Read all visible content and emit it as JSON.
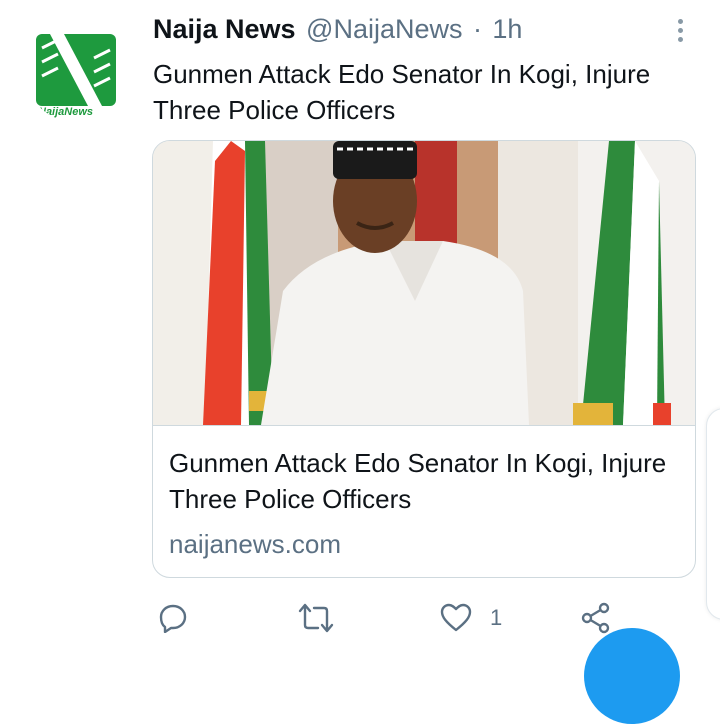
{
  "tweet": {
    "author_name": "Naija News",
    "handle": "@NaijaNews",
    "separator": "·",
    "time": "1h",
    "text": "Gunmen Attack Edo Senator In Kogi, Injure Three Police Officers",
    "avatar_label": "NaijaNews",
    "card": {
      "title": "Gunmen Attack Edo Senator In Kogi, Injure Three Police Officers",
      "domain": "naijanews.com"
    },
    "actions": {
      "reply_count": "",
      "retweet_count": "",
      "like_count": "1"
    }
  },
  "colors": {
    "brand_green": "#1e9a3e",
    "secondary_text": "#5b7083",
    "icon_gray": "#5b7083",
    "accent_blue": "#1d9bf0"
  },
  "icons": [
    "more-vertical-icon",
    "reply-icon",
    "retweet-icon",
    "like-icon",
    "share-icon"
  ]
}
